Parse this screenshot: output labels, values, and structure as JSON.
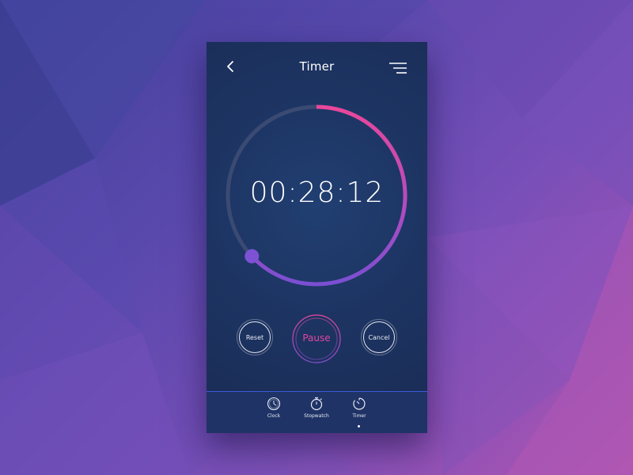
{
  "header": {
    "title": "Timer",
    "back_icon": "chevron-left-icon",
    "menu_icon": "menu-icon"
  },
  "timer": {
    "display": "00:28:12",
    "progress_fraction": 0.63
  },
  "controls": {
    "reset_label": "Reset",
    "pause_label": "Pause",
    "cancel_label": "Cancel"
  },
  "tabs": [
    {
      "label": "Clock",
      "icon": "clock-icon"
    },
    {
      "label": "Stopwatch",
      "icon": "stopwatch-icon"
    },
    {
      "label": "Timer",
      "icon": "timer-icon",
      "active": true
    }
  ],
  "colors": {
    "accent_pink": "#e8489c",
    "accent_purple": "#7d4fd0",
    "track": "#3a4a72",
    "panel": "#1d3462"
  }
}
